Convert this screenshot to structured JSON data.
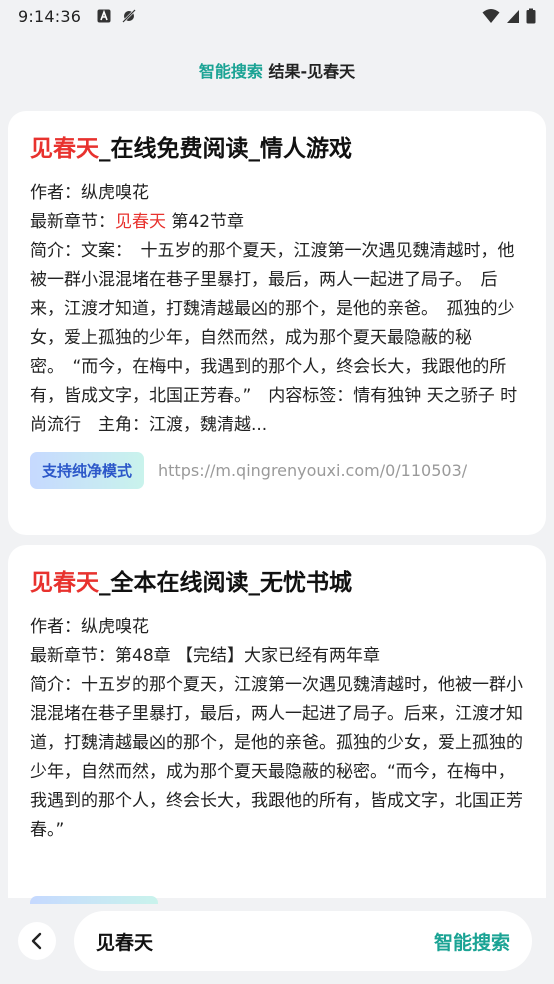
{
  "status_bar": {
    "time": "9:14:36",
    "left_icons": [
      "a-badge-icon",
      "signal-off-icon"
    ],
    "right_icons": [
      "wifi-icon",
      "cellular-icon",
      "battery-icon"
    ]
  },
  "header": {
    "accent": "智能搜索",
    "rest": " 结果-见春天"
  },
  "results": [
    {
      "title_highlight": "见春天",
      "title_rest": "_在线免费阅读_情人游戏",
      "author_label": "作者：",
      "author": "纵虎嗅花",
      "latest_label": "最新章节：",
      "latest_highlight": "见春天",
      "latest_rest": " 第42节章",
      "summary": "简介：文案：　十五岁的那个夏天，江渡第一次遇见魏清越时，他被一群小混混堵在巷子里暴打，最后，两人一起进了局子。　后来，江渡才知道，打魏清越最凶的那个，是他的亲爸。　孤独的少女，爱上孤独的少年，自然而然，成为那个夏天最隐蔽的秘密。　“而今，在梅中，我遇到的那个人，终会长大，我跟他的所有，皆成文字，北国正芳春。”　内容标签：情有独钟 天之骄子 时尚流行　主角：江渡，魏清越...",
      "badge": "支持纯净模式",
      "url": "https://m.qingrenyouxi.com/0/110503/"
    },
    {
      "title_highlight": "见春天",
      "title_rest": "_全本在线阅读_无忧书城",
      "author_label": "作者：",
      "author": "纵虎嗅花",
      "latest_label": "最新章节：",
      "latest_highlight": "",
      "latest_rest": "第48章 【完结】大家已经有两年章",
      "summary": "简介：十五岁的那个夏天，江渡第一次遇见魏清越时，他被一群小混混堵在巷子里暴打，最后，两人一起进了局子。后来，江渡才知道，打魏清越最凶的那个，是他的亲爸。孤独的少女，爱上孤独的少年，自然而然，成为那个夏天最隐蔽的秘密。“而今，在梅中，我遇到的那个人，终会长大，我跟他的所有，皆成文字，北国正芳春。”"
    }
  ],
  "bottom_bar": {
    "query": "见春天",
    "action": "智能搜索"
  },
  "colors": {
    "accent": "#1aa394",
    "highlight": "#e8322e",
    "background": "#f1f2f4",
    "badge_text": "#2b57c9"
  }
}
